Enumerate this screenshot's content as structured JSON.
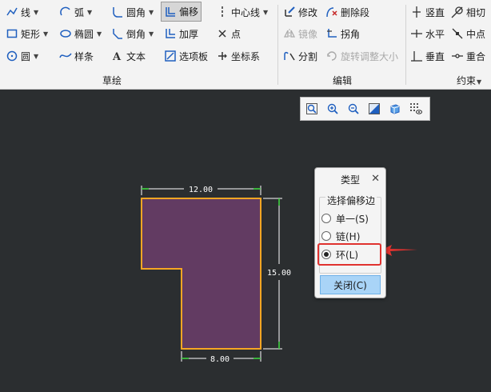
{
  "ribbon": {
    "sketch": {
      "group_label": "草绘",
      "line": "线",
      "arc": "弧",
      "fillet": "圆角",
      "offset": "偏移",
      "centerline": "中心线",
      "rectangle": "矩形",
      "ellipse": "椭圆",
      "chamfer": "倒角",
      "thicken": "加厚",
      "point": "点",
      "circle": "圆",
      "spline": "样条",
      "text": "文本",
      "palette": "选项板",
      "coord_system": "坐标系"
    },
    "edit": {
      "group_label": "编辑",
      "modify": "修改",
      "delete_segment": "删除段",
      "mirror": "镜像",
      "corner": "拐角",
      "divide": "分割",
      "rotate_resize": "旋转调整大小"
    },
    "constrain": {
      "group_label": "约束",
      "vertical": "竖直",
      "tangent": "相切",
      "horizontal": "水平",
      "midpoint": "中点",
      "perpendicular": "垂直",
      "coincident": "重合"
    }
  },
  "view_toolbar": {
    "icons": [
      "zoom-fit-icon",
      "zoom-in-icon",
      "zoom-out-icon",
      "repaint-icon",
      "display-style-icon",
      "sketch-display-icon"
    ]
  },
  "dialog": {
    "title": "类型",
    "group_label": "选择偏移边",
    "options": [
      {
        "label": "单一(S)",
        "checked": false
      },
      {
        "label": "链(H)",
        "checked": false
      },
      {
        "label": "环(L)",
        "checked": true
      }
    ],
    "close_button": "关闭(C)"
  },
  "sketch": {
    "dim_top": "12.00",
    "dim_right": "15.00",
    "dim_bottom": "8.00",
    "fill_color": "#623b62",
    "edge_color": "#f5a623",
    "dim_color": "#ffffff",
    "dim_end_color": "#3fd43f"
  },
  "colors": {
    "canvas_bg": "#2b2e30",
    "highlight_red": "#e0322f",
    "accent_blue": "#1f5fbf"
  }
}
